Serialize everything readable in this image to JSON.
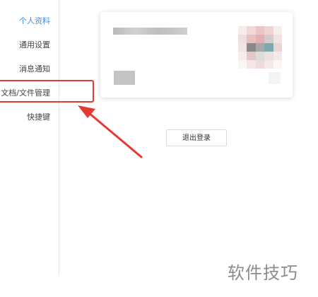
{
  "sidebar": {
    "items": [
      {
        "label": "个人资料",
        "active": true
      },
      {
        "label": "通用设置",
        "active": false
      },
      {
        "label": "消息通知",
        "active": false
      },
      {
        "label": "文档/文件管理",
        "active": false,
        "highlighted": true
      },
      {
        "label": "快捷键",
        "active": false
      }
    ]
  },
  "profile_card": {
    "name_blurred": true,
    "avatar_blurred": true
  },
  "logout_button": {
    "label": "退出登录"
  },
  "annotation": {
    "highlight_color": "#e53935",
    "arrow_color": "#e53935"
  },
  "watermark": {
    "text": "软件技巧"
  },
  "colors": {
    "active_nav": "#3f8de0",
    "text": "#444444",
    "divider": "#e8e8e8"
  }
}
